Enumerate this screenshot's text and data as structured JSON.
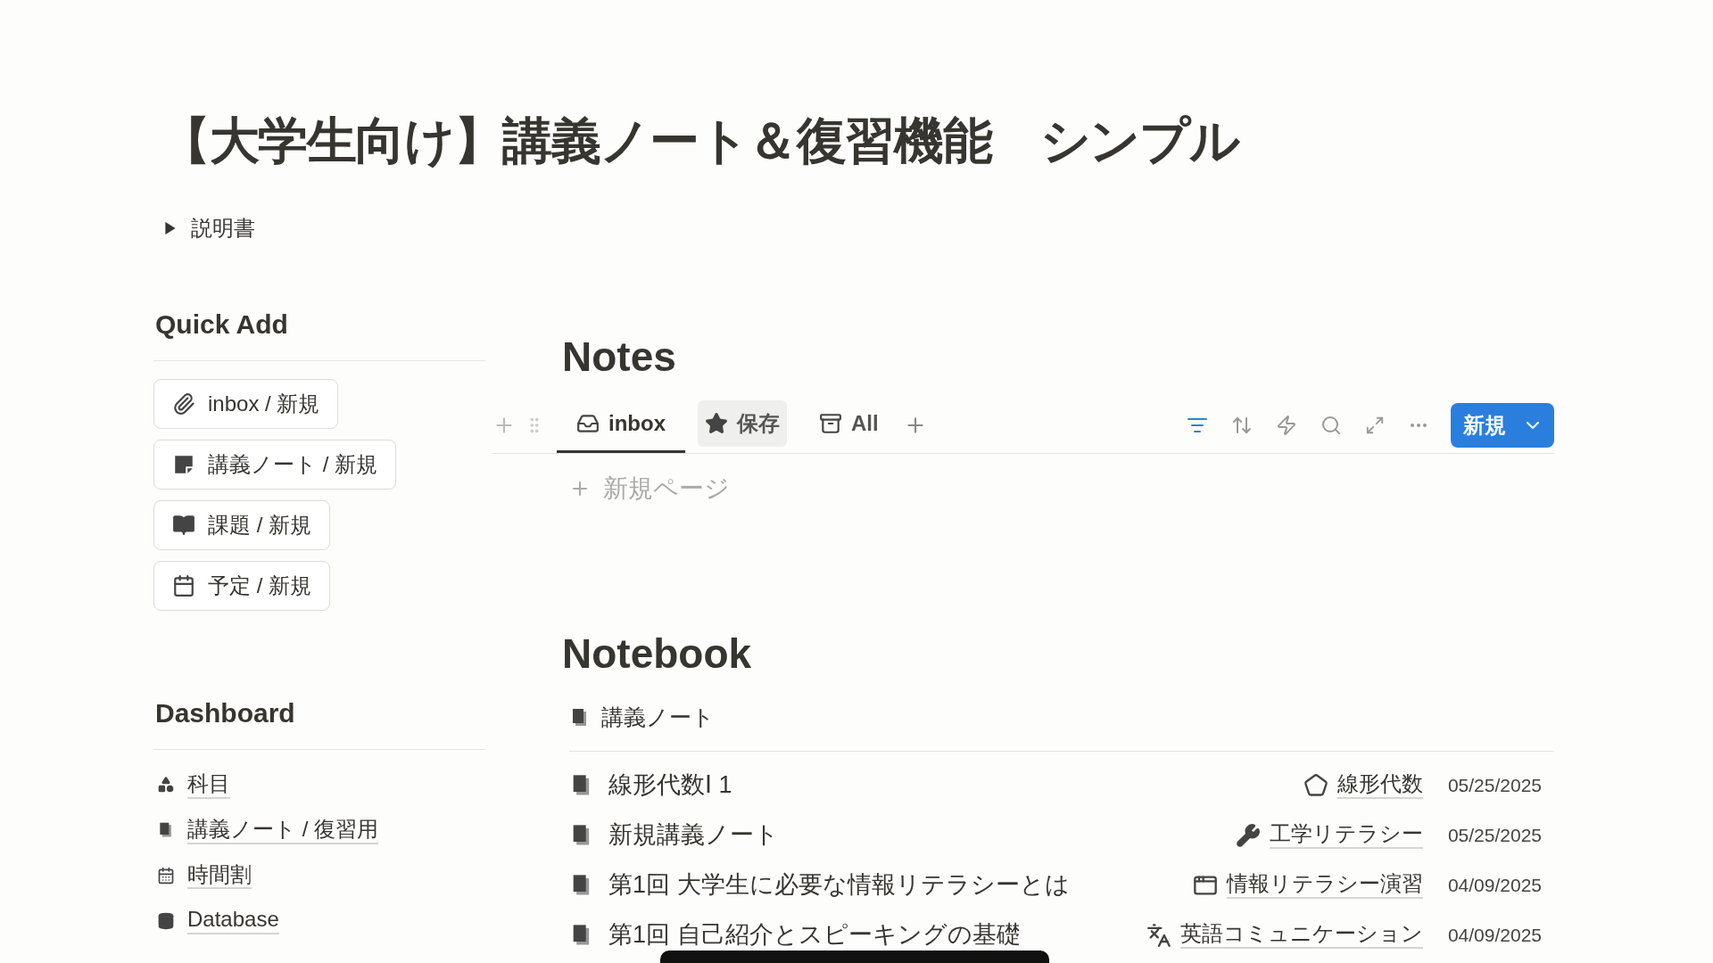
{
  "title": "【大学生向け】講義ノート＆復習機能　シンプル",
  "toggle": {
    "label": "説明書",
    "expanded": false
  },
  "quick_add": {
    "heading": "Quick Add",
    "buttons": [
      {
        "label": "inbox / 新規"
      },
      {
        "label": "講義ノート / 新規"
      },
      {
        "label": "課題 / 新規"
      },
      {
        "label": "予定 / 新規"
      }
    ]
  },
  "dashboard": {
    "heading": "Dashboard",
    "links": [
      {
        "label": "科目"
      },
      {
        "label": "講義ノート / 復習用"
      },
      {
        "label": "時間割"
      },
      {
        "label": "Database"
      }
    ]
  },
  "notes": {
    "heading": "Notes",
    "tabs": [
      {
        "label": "inbox",
        "selected": true,
        "hovered": false
      },
      {
        "label": "保存",
        "selected": false,
        "hovered": true
      },
      {
        "label": "All",
        "selected": false,
        "hovered": false
      }
    ],
    "new_page": "新規ページ",
    "new_button": "新規"
  },
  "notebook": {
    "heading": "Notebook",
    "group": "講義ノート",
    "rows": [
      {
        "title": "線形代数Ⅰ 1",
        "subject": "線形代数",
        "date": "05/25/2025"
      },
      {
        "title": "新規講義ノート",
        "subject": "工学リテラシー",
        "date": "05/25/2025"
      },
      {
        "title": "第1回 大学生に必要な情報リテラシーとは",
        "subject": "情報リテラシー演習",
        "date": "04/09/2025"
      },
      {
        "title": "第1回 自己紹介とスピーキングの基礎",
        "subject": "英語コミュニケーション",
        "date": "04/09/2025"
      }
    ]
  }
}
